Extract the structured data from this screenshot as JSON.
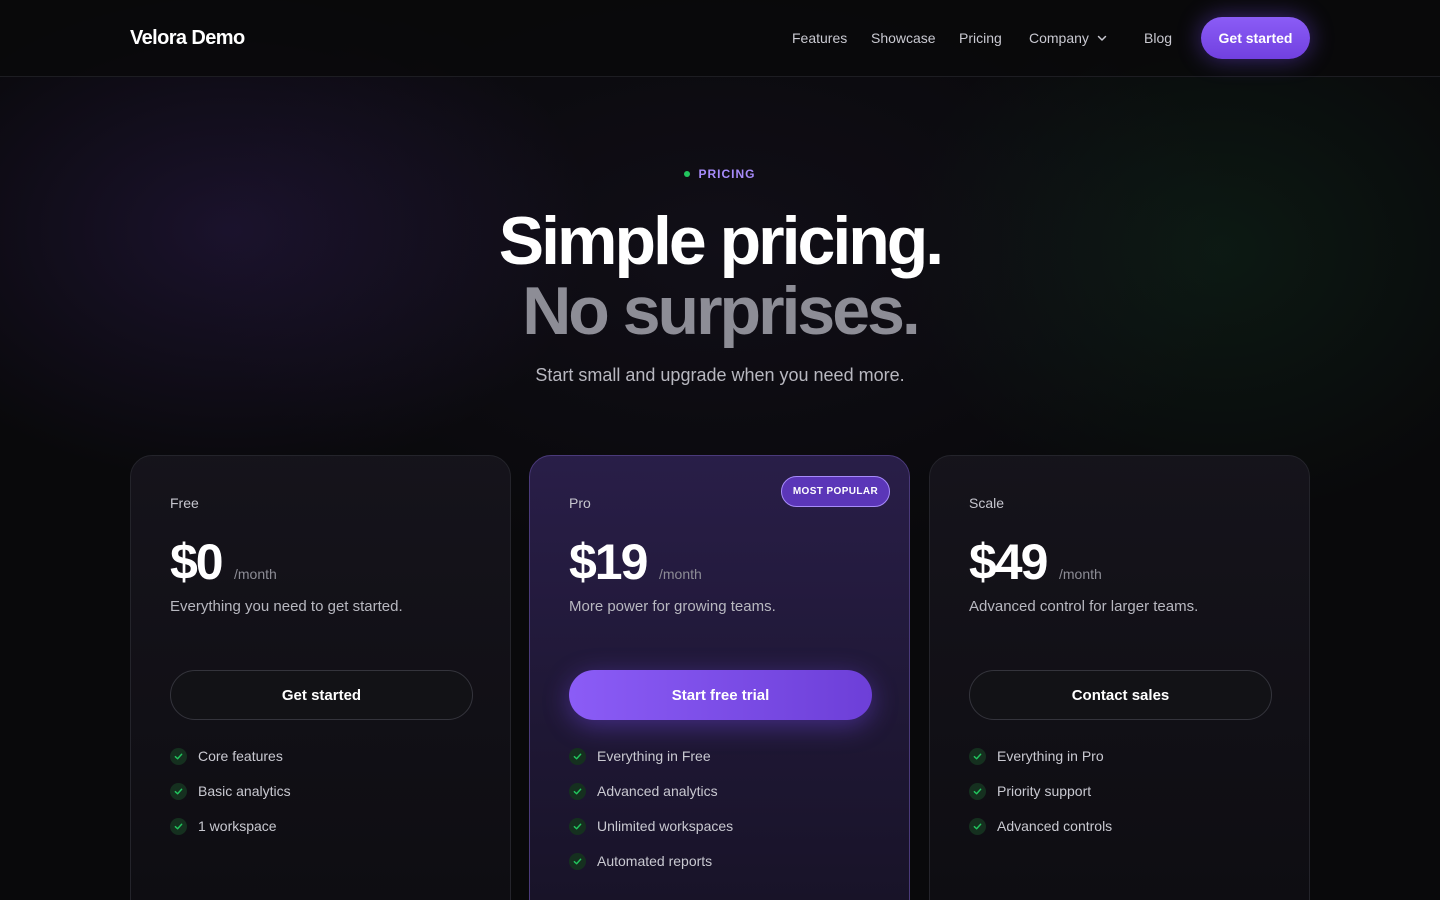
{
  "nav": {
    "brand": "Velora Demo",
    "links": [
      {
        "label": "Features"
      },
      {
        "label": "Showcase"
      },
      {
        "label": "Pricing"
      },
      {
        "label": "Company",
        "icon": "chevron-down-icon"
      },
      {
        "label": "Blog"
      }
    ],
    "cta": "Get started"
  },
  "hero": {
    "eyebrow": "PRICING",
    "title_line1": "Simple pricing.",
    "title_line2": "No surprises.",
    "subtitle": "Start small and upgrade when you need more."
  },
  "plans": [
    {
      "name": "Free",
      "price": "$0",
      "period": "/month",
      "description": "Everything you need to get started.",
      "button": "Get started",
      "features": [
        "Core features",
        "Basic analytics",
        "1 workspace"
      ]
    },
    {
      "name": "Pro",
      "badge": "MOST POPULAR",
      "price": "$19",
      "period": "/month",
      "description": "More power for growing teams.",
      "button": "Start free trial",
      "features": [
        "Everything in Free",
        "Advanced analytics",
        "Unlimited workspaces",
        "Automated reports"
      ]
    },
    {
      "name": "Scale",
      "price": "$49",
      "period": "/month",
      "description": "Advanced control for larger teams.",
      "button": "Contact sales",
      "features": [
        "Everything in Pro",
        "Priority support",
        "Advanced controls"
      ]
    }
  ],
  "colors": {
    "background": "#09090b",
    "accent": "#8b5cf6",
    "accent_text": "#a78bfa",
    "success": "#22c55e",
    "muted_text": "#8d8d96"
  }
}
